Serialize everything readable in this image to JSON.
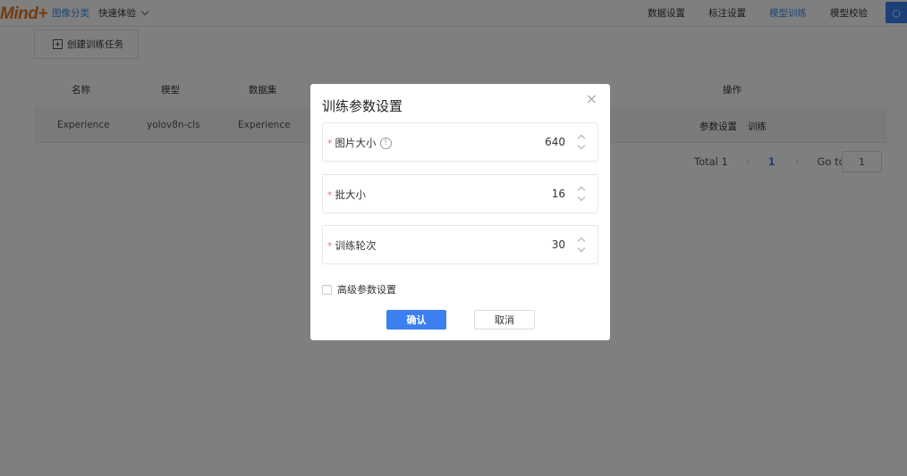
{
  "header": {
    "logo": "Mind+",
    "nav_left": [
      "图像分类",
      "快速体验"
    ],
    "nav_right": [
      "数据设置",
      "标注设置",
      "模型训练",
      "模型校验"
    ],
    "user_icon": "user-icon"
  },
  "toolbar": {
    "create_task_label": "创建训练任务"
  },
  "table": {
    "columns": [
      "名称",
      "模型",
      "数据集",
      "操作"
    ],
    "rows": [
      {
        "name": "Experience",
        "model": "yolov8n-cls",
        "dataset": "Experience",
        "actions": [
          "参数设置",
          "训练"
        ]
      }
    ]
  },
  "pagination": {
    "total_label": "Total 1",
    "current_page": "1",
    "goto_label": "Go to",
    "goto_value": "1"
  },
  "modal": {
    "title": "训练参数设置",
    "fields": [
      {
        "label": "图片大小",
        "value": "640",
        "has_info": true
      },
      {
        "label": "批大小",
        "value": "16",
        "has_info": false
      },
      {
        "label": "训练轮次",
        "value": "30",
        "has_info": false
      }
    ],
    "advanced_label": "高级参数设置",
    "confirm_label": "确认",
    "cancel_label": "取消"
  },
  "colors": {
    "accent": "#3b7ff0",
    "logo": "#e8781e",
    "required": "#f56c6c"
  }
}
